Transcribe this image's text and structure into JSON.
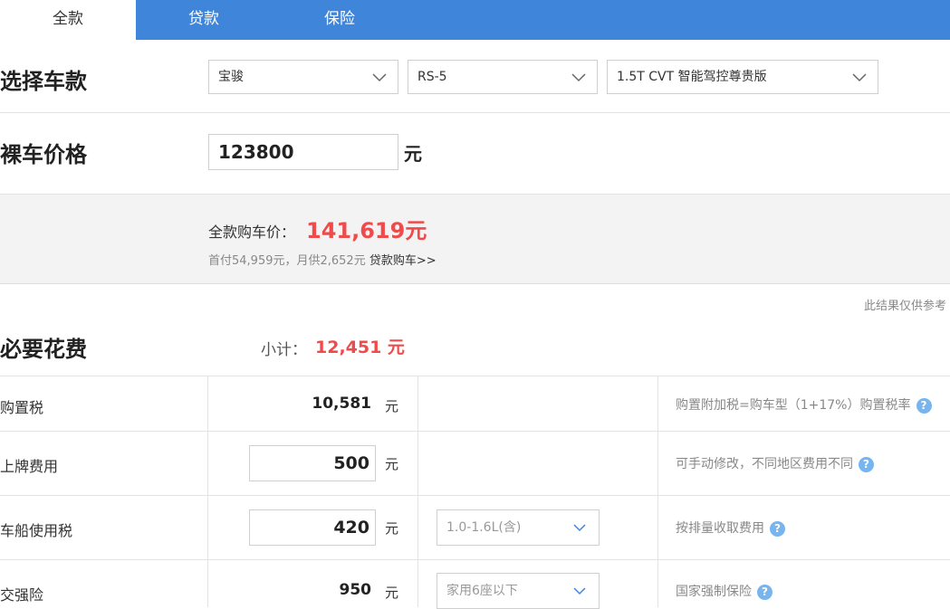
{
  "tabs": [
    {
      "label": "全款",
      "active": true
    },
    {
      "label": "贷款",
      "active": false
    },
    {
      "label": "保险",
      "active": false
    }
  ],
  "select_car": {
    "title": "选择车款",
    "brand": "宝骏",
    "model": "RS-5",
    "trim": "1.5T CVT 智能驾控尊贵版"
  },
  "bare_price": {
    "title": "裸车价格",
    "value": "123800",
    "unit": "元"
  },
  "summary": {
    "label": "全款购车价：",
    "total": "141,619元",
    "down_payment_text": "首付54,959元，月供2,652元",
    "loan_link": "贷款购车>>"
  },
  "disclaimer": "此结果仅供参考",
  "required_fees": {
    "title": "必要花费",
    "subtotal_label": "小计：",
    "subtotal_value": "12,451 元",
    "rows": [
      {
        "label": "购置税",
        "value": "10,581",
        "unit": "元",
        "editable": false,
        "hint": "购置附加税=购车型（1+17%）购置税率"
      },
      {
        "label": "上牌费用",
        "value": "500",
        "unit": "元",
        "editable": true,
        "hint": "可手动修改，不同地区费用不同"
      },
      {
        "label": "车船使用税",
        "value": "420",
        "unit": "元",
        "editable": true,
        "option": "1.0-1.6L(含)",
        "hint": "按排量收取费用"
      },
      {
        "label": "交强险",
        "value": "950",
        "unit": "元",
        "editable": false,
        "option": "家用6座以下",
        "hint": "国家强制保险"
      }
    ]
  },
  "colors": {
    "tab_bar": "#3f85d9",
    "price_red": "#f04b4b",
    "help_blue": "#78b4ee"
  },
  "icons": {
    "dropdown": "chevron-down-icon",
    "help": "question-mark-icon"
  }
}
